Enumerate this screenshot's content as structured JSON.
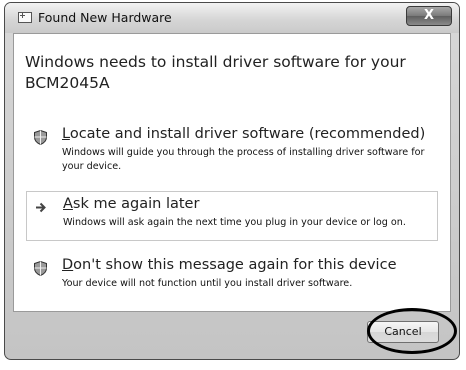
{
  "window": {
    "title": "Found New Hardware",
    "close_label": "X",
    "icon": "hardware-window-icon"
  },
  "heading": "Windows needs to install driver software for your BCM2045A",
  "options": [
    {
      "icon": "shield-icon",
      "accesskey": "L",
      "title_rest": "ocate and install driver software (recommended)",
      "description": "Windows will guide you through the process of installing driver software for your device."
    },
    {
      "icon": "arrow-right-icon",
      "accesskey": "A",
      "title_rest": "sk me again later",
      "description": "Windows will ask again the next time you plug in your device or log on."
    },
    {
      "icon": "shield-icon",
      "accesskey": "D",
      "title_rest": "on't show this message again for this device",
      "description": "Your device will not function until you install driver software."
    }
  ],
  "footer": {
    "cancel_label": "Cancel"
  }
}
